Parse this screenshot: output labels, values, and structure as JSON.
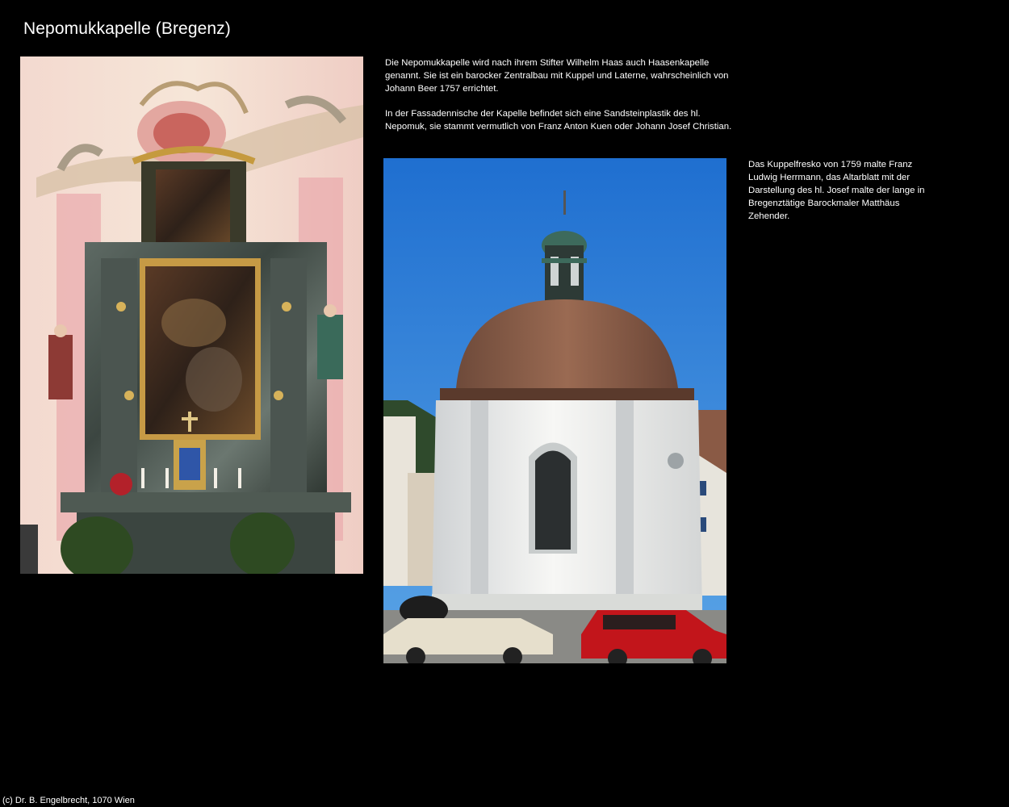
{
  "page": {
    "title": "Nepomukkapelle (Bregenz)",
    "footer": "(c) Dr. B. Engelbrecht, 1070 Wien"
  },
  "intro": {
    "paragraph1": "Die Nepomukkapelle wird nach ihrem Stifter Wilhelm Haas auch Haasenkapelle genannt. Sie ist ein barocker Zentralbau mit Kuppel und Laterne, wahrscheinlich von Johann Beer 1757 errichtet.",
    "paragraph2": "In der Fassadennische der Kapelle befindet sich eine Sandsteinplastik des hl. Nepomuk, sie stammt vermutlich von Franz Anton Kuen oder Johann Josef Christian."
  },
  "fresko": {
    "paragraph": "Das Kuppelfresko von 1759 malte Franz Ludwig Herrmann, das Altarblatt mit der Darstellung des hl. Josef malte der lange in Bregenztätige Barockmaler Matthäus Zehender."
  },
  "colors": {
    "background": "#000000",
    "text": "#ffffff"
  }
}
